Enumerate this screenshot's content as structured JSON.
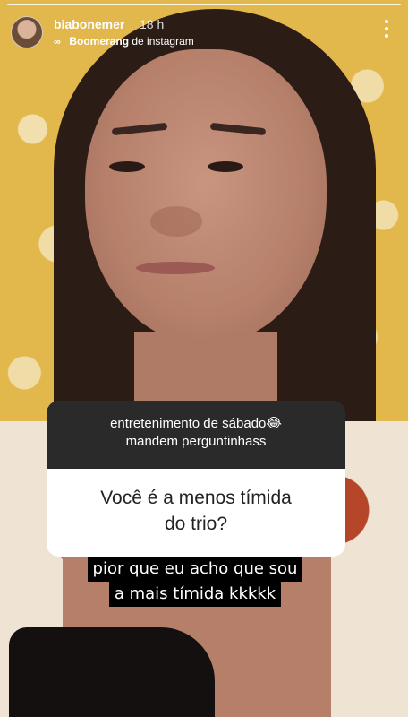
{
  "story": {
    "username": "biabonemer",
    "time_ago": "18 h",
    "source_icon": "boomerang-icon",
    "source_app": "Boomerang",
    "source_suffix": "de instagram",
    "menu_icon": "more-vertical-icon"
  },
  "question_sticker": {
    "prompt_line1": "entretenimento de sábado😂",
    "prompt_line2": "mandem perguntinhass",
    "question_line1": "Você é a menos tímida",
    "question_line2": "do trio?"
  },
  "answer": {
    "line1": "pior que eu acho que sou",
    "line2": "a mais tímida kkkkk"
  },
  "colors": {
    "sticker_header": "#2a2a2a",
    "sticker_body": "#ffffff",
    "caption_bg": "#000000"
  }
}
